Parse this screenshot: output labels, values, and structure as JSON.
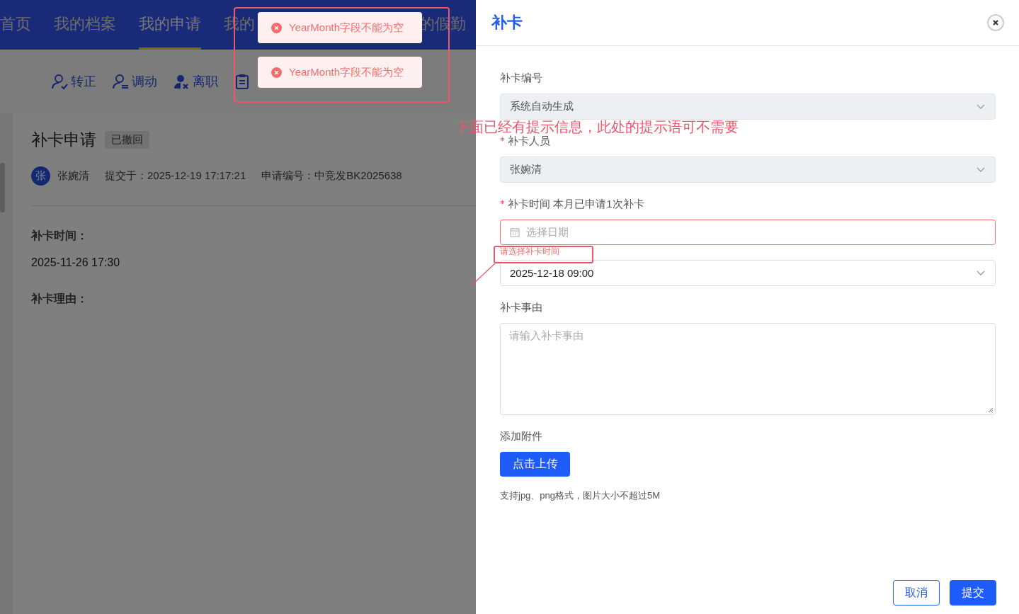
{
  "nav": {
    "items": [
      {
        "label": "首页",
        "selected": false
      },
      {
        "label": "我的档案",
        "selected": false
      },
      {
        "label": "我的申请",
        "selected": true
      },
      {
        "label": "我的",
        "selected": false
      },
      {
        "label": "的假勤",
        "selected": false
      }
    ]
  },
  "toolbar": {
    "actions": [
      {
        "kind": "regularize",
        "label": "转正"
      },
      {
        "kind": "transfer",
        "label": "调动"
      },
      {
        "kind": "resign",
        "label": "离职"
      }
    ]
  },
  "detail": {
    "title": "补卡申请",
    "status": "已撤回",
    "avatar": "张",
    "name": "张婉清",
    "submitted": "提交于：2025-12-19 17:17:21",
    "number": "申请编号：中竞发BK2025638",
    "fields": [
      {
        "label": "补卡时间：",
        "value": "2025-11-26 17:30"
      },
      {
        "label": "补卡理由："
      }
    ]
  },
  "toasts": [
    {
      "message": "YearMonth字段不能为空"
    },
    {
      "message": "YearMonth字段不能为空"
    }
  ],
  "drawer": {
    "title": "补卡",
    "fields": [
      {
        "kind": "select",
        "label": "补卡编号",
        "required": false,
        "disabled": true,
        "value": "系统自动生成"
      },
      {
        "kind": "select",
        "label": "补卡人员",
        "required": true,
        "disabled": true,
        "value": "张婉清"
      },
      {
        "kind": "date",
        "label": "补卡时间 本月已申请1次补卡",
        "required": true,
        "placeholder": "选择日期",
        "error": "请选择补卡时间"
      },
      {
        "kind": "select",
        "disabled": false,
        "value": "2025-12-18 09:00"
      },
      {
        "kind": "textarea",
        "label": "补卡事由",
        "required": false,
        "placeholder": "请输入补卡事由"
      },
      {
        "kind": "upload",
        "label": "添加附件",
        "required": false,
        "button": "点击上传",
        "hint": "支持jpg、png格式，图片大小不超过5M"
      }
    ],
    "buttons": [
      {
        "label": "取消",
        "primary": false
      },
      {
        "label": "提交",
        "primary": true
      }
    ]
  },
  "annotation": {
    "note": "下面已经有提示信息，此处的提示语可不需要"
  }
}
